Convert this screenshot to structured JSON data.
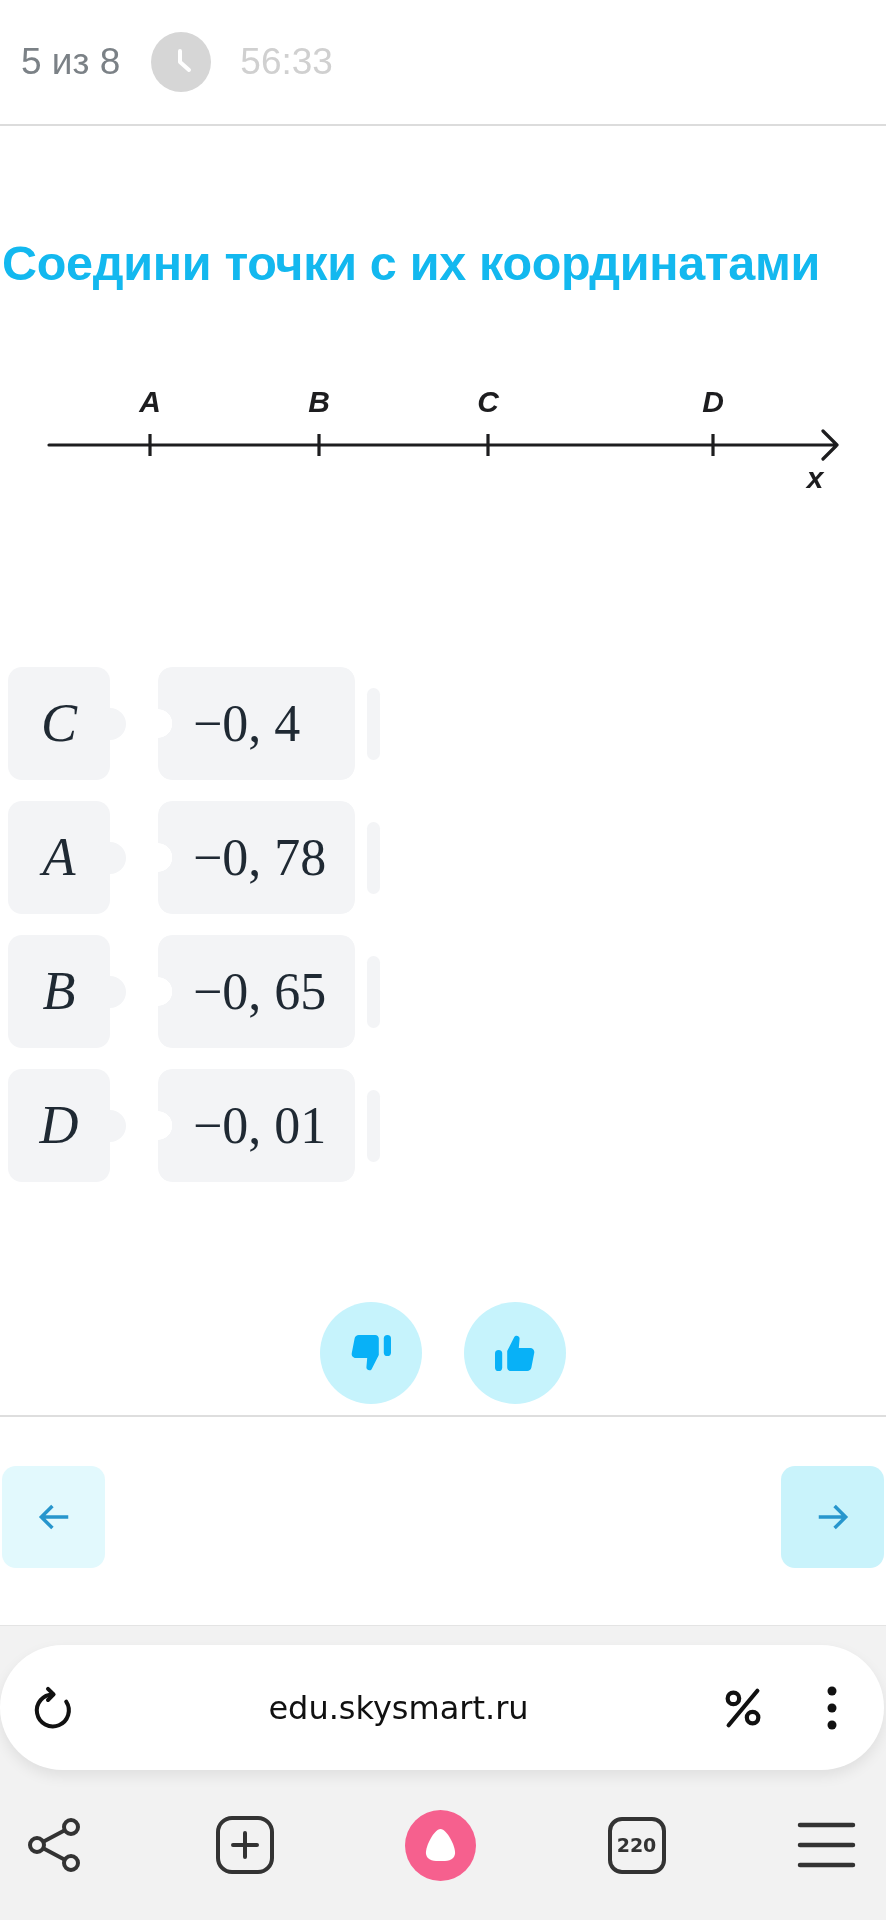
{
  "header": {
    "progress": "5 из 8",
    "timer": "56:33"
  },
  "task": {
    "title": "Соедини точки с их координатами"
  },
  "number_line": {
    "points": [
      "A",
      "B",
      "C",
      "D"
    ],
    "axis_label": "x"
  },
  "pairs": [
    {
      "point": "C",
      "value": "−0, 4"
    },
    {
      "point": "A",
      "value": "−0, 78"
    },
    {
      "point": "B",
      "value": "−0, 65"
    },
    {
      "point": "D",
      "value": "−0, 01"
    }
  ],
  "feedback": [
    {
      "kind": "dislike"
    },
    {
      "kind": "like"
    }
  ],
  "navigation": [
    {
      "kind": "back",
      "disabled": true
    },
    {
      "kind": "next",
      "disabled": false
    }
  ],
  "browser": {
    "url": "edu.skysmart.ru",
    "tab_count": "220"
  }
}
